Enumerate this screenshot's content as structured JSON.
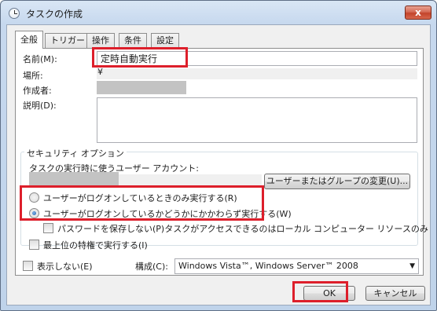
{
  "window": {
    "title": "タスクの作成",
    "close_glyph": "x"
  },
  "tabs": [
    {
      "label": "全般",
      "active": true
    },
    {
      "label": "トリガー"
    },
    {
      "label": "操作"
    },
    {
      "label": "条件"
    },
    {
      "label": "設定"
    }
  ],
  "general": {
    "name_label": "名前(M):",
    "name_value": "定時自動実行",
    "location_label": "場所:",
    "location_value": "¥",
    "author_label": "作成者:",
    "description_label": "説明(D):",
    "description_value": ""
  },
  "security": {
    "legend": "セキュリティ オプション",
    "account_label": "タスクの実行時に使うユーザー アカウント:",
    "change_user_button": "ユーザーまたはグループの変更(U)...",
    "radio_logged_on_only": "ユーザーがログオンしているときのみ実行する(R)",
    "radio_whether_logged_on": "ユーザーがログオンしているかどうかにかかわらず実行する(W)",
    "selected_option": "whether_logged_on",
    "no_store_password": "パスワードを保存しない(P)タスクがアクセスできるのはローカル コンピューター リソースのみ",
    "highest_privileges": "最上位の特権で実行する(I)"
  },
  "footer": {
    "hidden_label": "表示しない(E)",
    "configure_label": "構成(C):",
    "configure_value": "Windows Vista™, Windows Server™ 2008",
    "ok_button": "OK",
    "cancel_button": "キャンセル"
  },
  "colors": {
    "highlight": "#dd1f2b",
    "accent": "#1f5fae"
  }
}
